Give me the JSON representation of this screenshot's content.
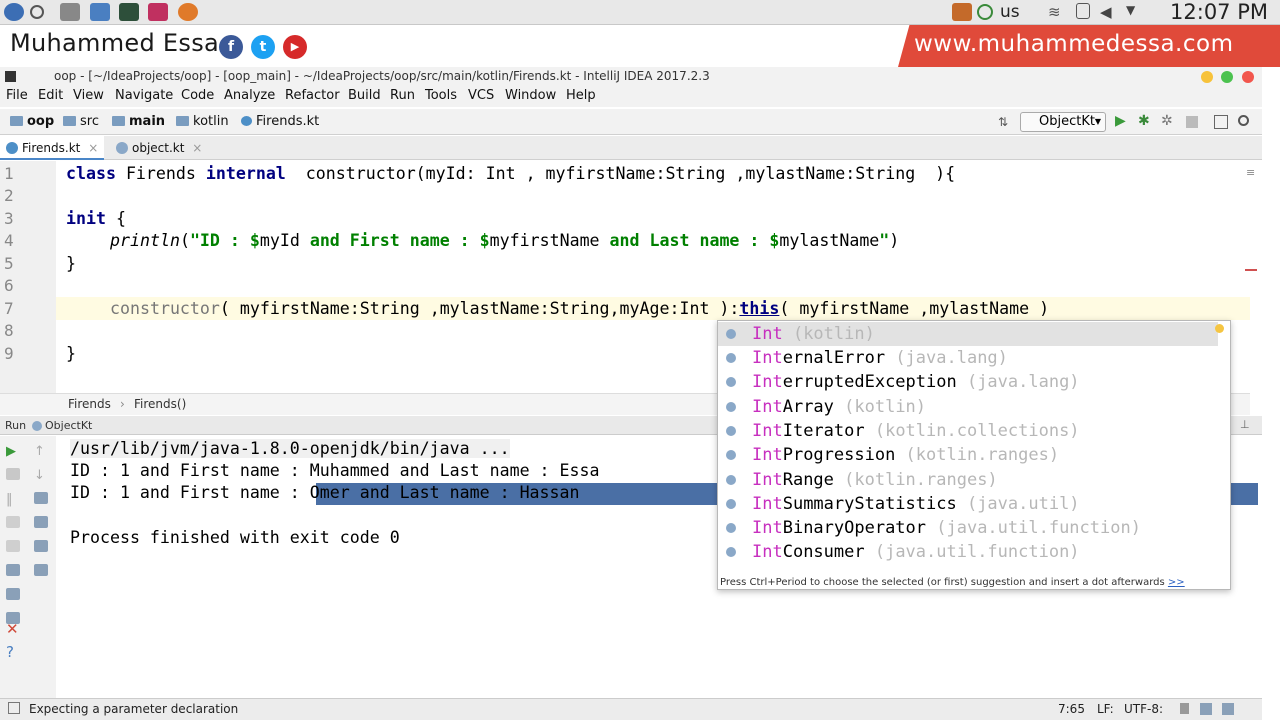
{
  "system": {
    "keyboard": "us",
    "clock": "12:07 PM"
  },
  "banner": {
    "author": "Muhammed Essa",
    "website": "www.muhammedessa.com",
    "social": [
      "f",
      "t",
      "▶"
    ]
  },
  "window": {
    "title": "oop - [~/IdeaProjects/oop] - [oop_main] - ~/IdeaProjects/oop/src/main/kotlin/Firends.kt - IntelliJ IDEA 2017.2.3"
  },
  "menu": [
    "File",
    "Edit",
    "View",
    "Navigate",
    "Code",
    "Analyze",
    "Refactor",
    "Build",
    "Run",
    "Tools",
    "VCS",
    "Window",
    "Help"
  ],
  "breadcrumbs": [
    "oop",
    "src",
    "main",
    "kotlin",
    "Firends.kt"
  ],
  "run_config": "ObjectKt",
  "tabs": [
    {
      "label": "Firends.kt",
      "close": "×"
    },
    {
      "label": "object.kt",
      "close": "×"
    }
  ],
  "editor": {
    "line_numbers": [
      "1",
      "2",
      "3",
      "4",
      "5",
      "6",
      "7",
      "8",
      "9"
    ],
    "line1": {
      "a": "class",
      "b": " Firends ",
      "c": "internal",
      "d": "  constructor(myId: Int , myfirstName:String ,mylastName:String  ){"
    },
    "line3": {
      "a": "init",
      "b": " {"
    },
    "line4": {
      "fn": "println",
      "a": "(",
      "s1": "\"ID : $",
      "v1": "myId ",
      "s2": "and First name : $",
      "v2": "myfirstName ",
      "s3": "and Last name : $",
      "v3": "mylastName",
      "s4": "\"",
      "end": ")"
    },
    "line5": "}",
    "line7": {
      "a": "constructor",
      "b": "( myfirstName:String ,mylastName:String,myAge:Int ):",
      "c": "this",
      "d": "( myfirstName ,mylastName )"
    },
    "line9": "}",
    "breadcrumb": [
      "Firends",
      "Firends()"
    ]
  },
  "run_panel": {
    "header": "Run",
    "config": "ObjectKt",
    "lines": [
      "/usr/lib/jvm/java-1.8.0-openjdk/bin/java ...",
      "ID : 1 and First name : Muhammed and Last name : Essa",
      "ID : 1 and First name : Omer and Last name : Hassan",
      "",
      "Process finished with exit code 0"
    ]
  },
  "completion": {
    "prefix": "Int",
    "items": [
      {
        "match": "Int",
        "rest": "",
        "pkg": " (kotlin)"
      },
      {
        "match": "Int",
        "rest": "ernalError",
        "pkg": " (java.lang)"
      },
      {
        "match": "Int",
        "rest": "erruptedException",
        "pkg": " (java.lang)"
      },
      {
        "match": "Int",
        "rest": "Array",
        "pkg": " (kotlin)"
      },
      {
        "match": "Int",
        "rest": "Iterator",
        "pkg": " (kotlin.collections)"
      },
      {
        "match": "Int",
        "rest": "Progression",
        "pkg": " (kotlin.ranges)"
      },
      {
        "match": "Int",
        "rest": "Range",
        "pkg": " (kotlin.ranges)"
      },
      {
        "match": "Int",
        "rest": "SummaryStatistics",
        "pkg": " (java.util)"
      },
      {
        "match": "Int",
        "rest": "BinaryOperator",
        "pkg": " (java.util.function)"
      },
      {
        "match": "Int",
        "rest": "Consumer",
        "pkg": " (java.util.function)"
      }
    ],
    "hint": "Press Ctrl+Period to choose the selected (or first) suggestion and insert a dot afterwards",
    "hint_link": ">>"
  },
  "status": {
    "message": "Expecting a parameter declaration",
    "position": "7:65",
    "line_sep": "LF:",
    "encoding": "UTF-8:"
  },
  "colors": {
    "accent": "#4a6fa5",
    "banner_red": "#e04a3a",
    "keyword": "#000080",
    "string": "#008000",
    "match": "#c72fbf"
  }
}
